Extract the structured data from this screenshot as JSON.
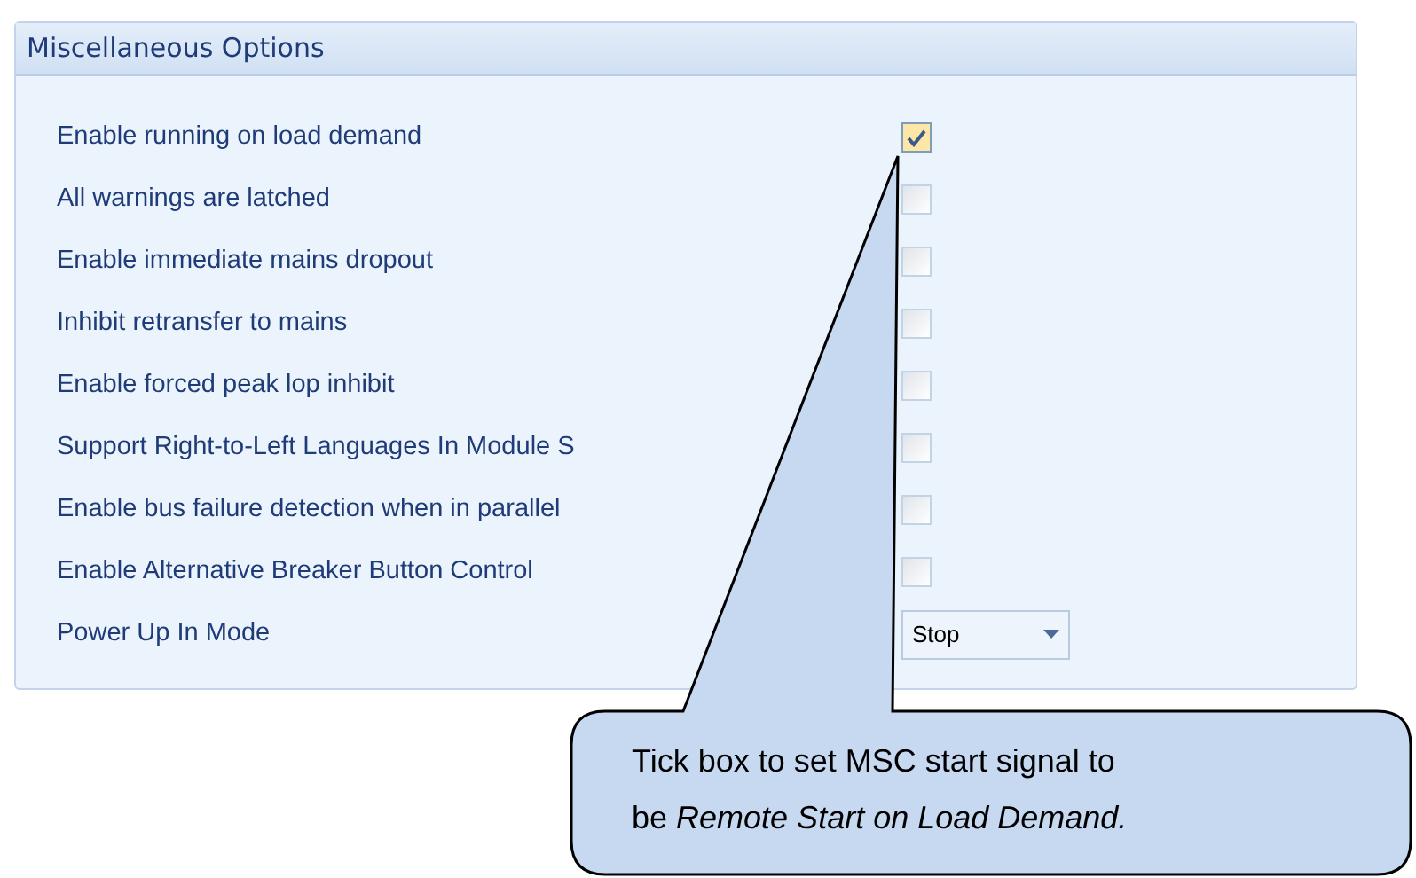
{
  "panel": {
    "title": "Miscellaneous Options",
    "rows": [
      {
        "kind": "checkbox",
        "label": "Enable running on load demand",
        "checked": true
      },
      {
        "kind": "checkbox",
        "label": "All warnings are latched",
        "checked": false
      },
      {
        "kind": "checkbox",
        "label": "Enable immediate mains dropout",
        "checked": false
      },
      {
        "kind": "checkbox",
        "label": "Inhibit retransfer to mains",
        "checked": false
      },
      {
        "kind": "checkbox",
        "label": "Enable forced peak lop inhibit",
        "checked": false
      },
      {
        "kind": "checkbox",
        "label": "Support Right-to-Left Languages In Module S",
        "checked": false
      },
      {
        "kind": "checkbox",
        "label": "Enable bus failure detection when in parallel",
        "checked": false
      },
      {
        "kind": "checkbox",
        "label": "Enable Alternative Breaker Button Control",
        "checked": false
      },
      {
        "kind": "dropdown",
        "label": "Power Up In Mode",
        "value": "Stop"
      }
    ]
  },
  "callout": {
    "lines": [
      "Tick box to set MSC start signal to",
      "be *Remote Start on Load Demand.*"
    ]
  }
}
